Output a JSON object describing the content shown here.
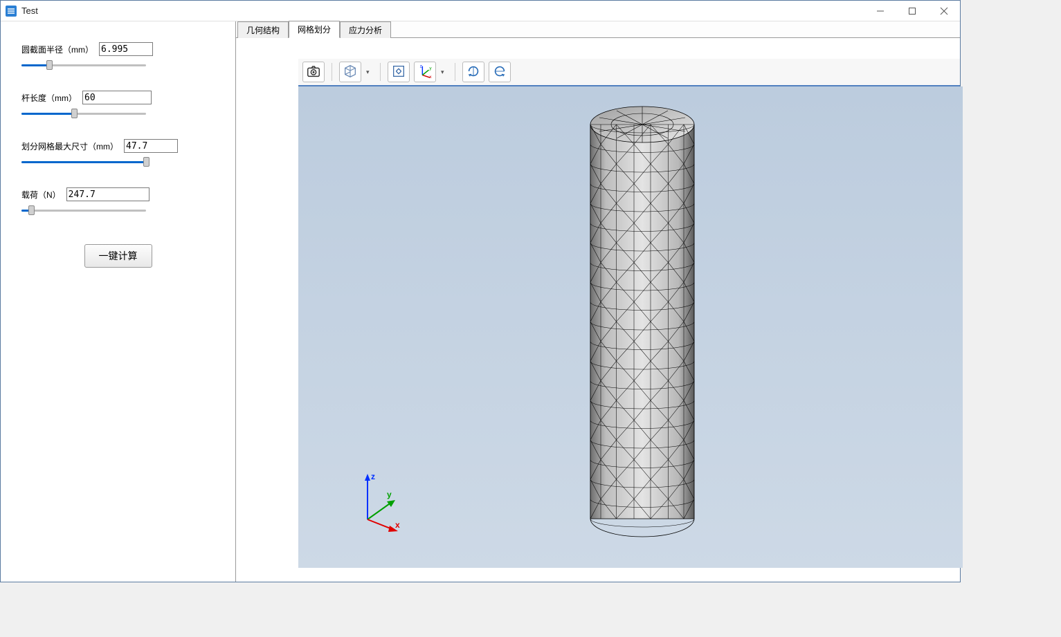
{
  "window": {
    "title": "Test"
  },
  "sidebar": {
    "params": [
      {
        "label": "圆截面半径（mm）",
        "value": "6.995",
        "slider_pct": 22
      },
      {
        "label": "杆长度（mm）",
        "value": "60",
        "slider_pct": 42
      },
      {
        "label": "划分网格最大尺寸（mm）",
        "value": "47.7",
        "slider_pct": 100
      },
      {
        "label": "载荷（N）",
        "value": "247.7",
        "slider_pct": 8
      }
    ],
    "calc_button": "一键计算"
  },
  "tabs": {
    "items": [
      "几何结构",
      "网格划分",
      "应力分析"
    ],
    "active": 1
  },
  "toolbar": {
    "buttons": [
      {
        "name": "screenshot-icon"
      },
      {
        "name": "view-cube-icon",
        "dropdown": true
      },
      {
        "name": "fit-view-icon"
      },
      {
        "name": "axes-icon",
        "dropdown": true
      },
      {
        "name": "rotate-cw-icon"
      },
      {
        "name": "rotate-ccw-icon"
      }
    ]
  },
  "axes_labels": {
    "x": "x",
    "y": "y",
    "z": "z"
  }
}
